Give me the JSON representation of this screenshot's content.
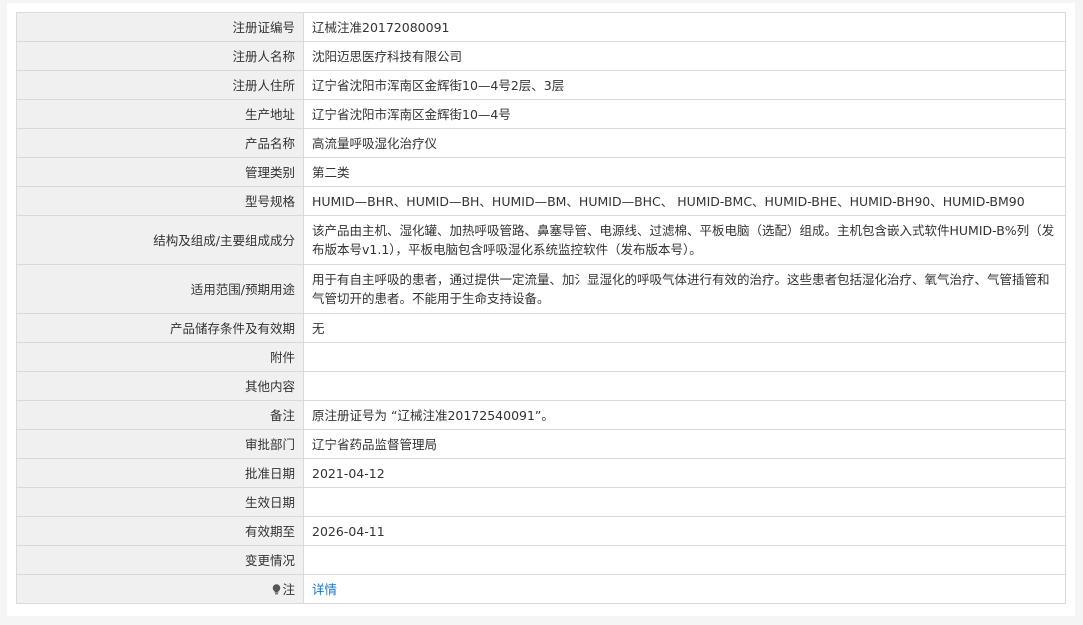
{
  "rows": [
    {
      "label": "注册证编号",
      "value": "辽械注准20172080091"
    },
    {
      "label": "注册人名称",
      "value": "沈阳迈思医疗科技有限公司"
    },
    {
      "label": "注册人住所",
      "value": "辽宁省沈阳市浑南区金辉街10—4号2层、3层"
    },
    {
      "label": "生产地址",
      "value": "辽宁省沈阳市浑南区金辉街10—4号"
    },
    {
      "label": "产品名称",
      "value": "高流量呼吸湿化治疗仪"
    },
    {
      "label": "管理类别",
      "value": "第二类"
    },
    {
      "label": "型号规格",
      "value": "HUMID—BHR、HUMID—BH、HUMID—BM、HUMID—BHC、 HUMID-BMC、HUMID-BHE、HUMID-BH90、HUMID-BM90"
    },
    {
      "label": "结构及组成/主要组成成分",
      "value": "该产品由主机、湿化罐、加热呼吸管路、鼻塞导管、电源线、过滤棉、平板电脑（选配）组成。主机包含嵌入式软件HUMID-B%列（发布版本号v1.1），平板电脑包含呼吸湿化系统监控软件（发布版本号）。"
    },
    {
      "label": "适用范围/预期用途",
      "value": "用于有自主呼吸的患者，通过提供一定流量、加氵显湿化的呼吸气体进行有效的治疗。这些患者包括湿化治疗、氧气治疗、气管插管和气管切开的患者。不能用于生命支持设备。"
    },
    {
      "label": "产品储存条件及有效期",
      "value": "无"
    },
    {
      "label": "附件",
      "value": ""
    },
    {
      "label": "其他内容",
      "value": ""
    },
    {
      "label": "备注",
      "value": "原注册证号为 “辽械注准20172540091”。"
    },
    {
      "label": "审批部门",
      "value": "辽宁省药品监督管理局"
    },
    {
      "label": "批准日期",
      "value": "2021-04-12"
    },
    {
      "label": "生效日期",
      "value": ""
    },
    {
      "label": "有效期至",
      "value": "2026-04-11"
    },
    {
      "label": "变更情况",
      "value": ""
    }
  ],
  "note_row": {
    "label": "注",
    "link_text": "详情",
    "icon": "light-bulb-icon"
  }
}
